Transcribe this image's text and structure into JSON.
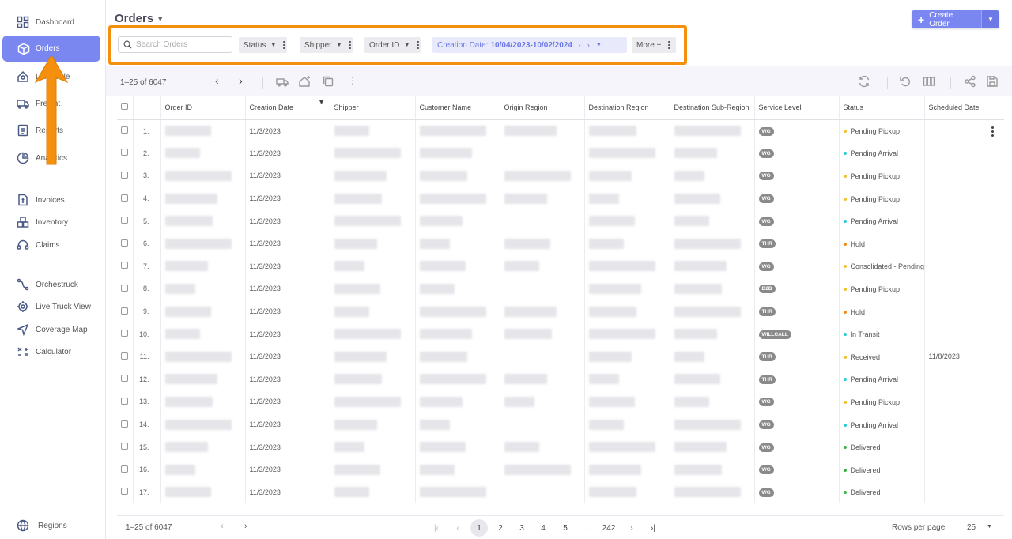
{
  "sidebar": {
    "items": [
      {
        "label": "Dashboard",
        "icon": "dashboard-icon"
      },
      {
        "label": "Orders",
        "icon": "box-icon"
      },
      {
        "label": "Linehaule",
        "icon": "linehaul-icon"
      },
      {
        "label": "Freight",
        "icon": "truck-icon"
      },
      {
        "label": "Reports",
        "icon": "reports-icon"
      },
      {
        "label": "Analytics",
        "icon": "analytics-icon"
      },
      {
        "label": "Invoices",
        "icon": "invoice-icon"
      },
      {
        "label": "Inventory",
        "icon": "inventory-icon"
      },
      {
        "label": "Claims",
        "icon": "headset-icon"
      },
      {
        "label": "Orchestruck",
        "icon": "route-icon"
      },
      {
        "label": "Live Truck View",
        "icon": "target-icon"
      },
      {
        "label": "Coverage Map",
        "icon": "navigation-icon"
      },
      {
        "label": "Calculator",
        "icon": "calculator-icon"
      }
    ],
    "footer": {
      "label": "Regions",
      "icon": "globe-icon"
    }
  },
  "header": {
    "title": "Orders",
    "create_label": "Create Order"
  },
  "filters": {
    "search_placeholder": "Search Orders",
    "status": "Status",
    "shipper": "Shipper",
    "order_id": "Order ID",
    "date_label": "Creation Date:",
    "date_value": "10/04/2023-10/02/2024",
    "more": "More +"
  },
  "toolbar": {
    "range": "1–25 of 6047"
  },
  "table": {
    "columns": [
      "Order ID",
      "Creation Date",
      "Shipper",
      "Customer Name",
      "Origin Region",
      "Destination Region",
      "Destination Sub-Region",
      "Service Level",
      "Status",
      "Scheduled Date"
    ],
    "rows": [
      {
        "n": "1.",
        "date": "11/3/2023",
        "svc": "WG",
        "status": "Pending Pickup",
        "color": "#f2c230",
        "sched": ""
      },
      {
        "n": "2.",
        "date": "11/3/2023",
        "svc": "WG",
        "status": "Pending Arrival",
        "color": "#2ec9d6",
        "sched": ""
      },
      {
        "n": "3.",
        "date": "11/3/2023",
        "svc": "WG",
        "status": "Pending Pickup",
        "color": "#f2c230",
        "sched": ""
      },
      {
        "n": "4.",
        "date": "11/3/2023",
        "svc": "WG",
        "status": "Pending Pickup",
        "color": "#f2c230",
        "sched": ""
      },
      {
        "n": "5.",
        "date": "11/3/2023",
        "svc": "WG",
        "status": "Pending Arrival",
        "color": "#2ec9d6",
        "sched": ""
      },
      {
        "n": "6.",
        "date": "11/3/2023",
        "svc": "THR",
        "status": "Hold",
        "color": "#f08c1a",
        "sched": ""
      },
      {
        "n": "7.",
        "date": "11/3/2023",
        "svc": "WG",
        "status": "Consolidated - Pending",
        "color": "#f2c230",
        "sched": ""
      },
      {
        "n": "8.",
        "date": "11/3/2023",
        "svc": "B2B",
        "status": "Pending Pickup",
        "color": "#f2c230",
        "sched": ""
      },
      {
        "n": "9.",
        "date": "11/3/2023",
        "svc": "THR",
        "status": "Hold",
        "color": "#f08c1a",
        "sched": ""
      },
      {
        "n": "10.",
        "date": "11/3/2023",
        "svc": "WILLCALL",
        "status": "In Transit",
        "color": "#2ec9d6",
        "sched": ""
      },
      {
        "n": "11.",
        "date": "11/3/2023",
        "svc": "THR",
        "status": "Received",
        "color": "#f2c230",
        "sched": "11/8/2023"
      },
      {
        "n": "12.",
        "date": "11/3/2023",
        "svc": "THR",
        "status": "Pending Arrival",
        "color": "#2ec9d6",
        "sched": ""
      },
      {
        "n": "13.",
        "date": "11/3/2023",
        "svc": "WG",
        "status": "Pending Pickup",
        "color": "#f2c230",
        "sched": ""
      },
      {
        "n": "14.",
        "date": "11/3/2023",
        "svc": "WG",
        "status": "Pending Arrival",
        "color": "#2ec9d6",
        "sched": ""
      },
      {
        "n": "15.",
        "date": "11/3/2023",
        "svc": "WG",
        "status": "Delivered",
        "color": "#3cb34a",
        "sched": ""
      },
      {
        "n": "16.",
        "date": "11/3/2023",
        "svc": "WG",
        "status": "Delivered",
        "color": "#3cb34a",
        "sched": ""
      },
      {
        "n": "17.",
        "date": "11/3/2023",
        "svc": "WG",
        "status": "Delivered",
        "color": "#3cb34a",
        "sched": ""
      }
    ]
  },
  "pagination": {
    "range": "1–25 of 6047",
    "pages": [
      "1",
      "2",
      "3",
      "4",
      "5",
      "...",
      "242"
    ],
    "rows_per_page_label": "Rows per page",
    "rows_per_page": "25"
  },
  "colors": {
    "accent": "#7b87f0",
    "highlight": "#f5900f"
  }
}
